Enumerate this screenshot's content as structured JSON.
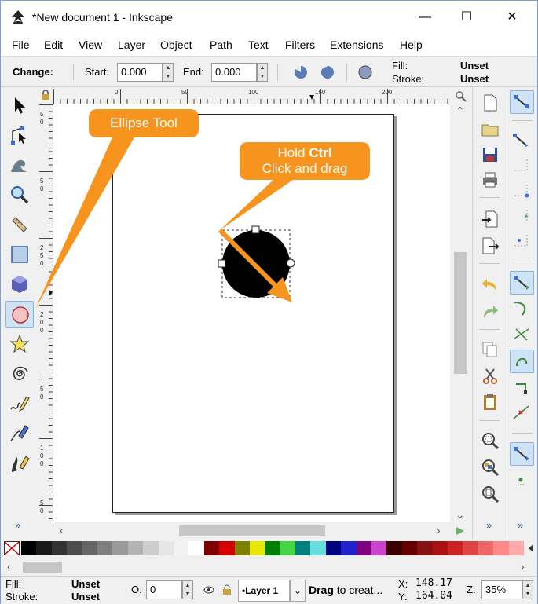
{
  "window": {
    "title": "*New document 1 - Inkscape",
    "minimize": "—",
    "maximize": "☐",
    "close": "✕"
  },
  "menu": [
    "File",
    "Edit",
    "View",
    "Layer",
    "Object",
    "Path",
    "Text",
    "Filters",
    "Extensions",
    "Help"
  ],
  "controls": {
    "change_label": "Change:",
    "start_label": "Start:",
    "start_value": "0.000",
    "end_label": "End:",
    "end_value": "0.000",
    "fill_label": "Fill:",
    "fill_value": "Unset",
    "stroke_label": "Stroke:",
    "stroke_value": "Unset"
  },
  "ruler": {
    "h": [
      "0",
      "50",
      "100",
      "150",
      "200"
    ],
    "v": [
      "5",
      "0",
      "5",
      "0",
      "2",
      "5",
      "0",
      "2",
      "0",
      "0",
      "1",
      "5",
      "0",
      "1",
      "0",
      "0",
      "5",
      "0"
    ]
  },
  "callouts": {
    "ellipse_tool": "Ellipse Tool",
    "hold": "Hold",
    "ctrl": "Ctrl",
    "click_drag": "Click  and drag"
  },
  "toolbox_more": "»",
  "cmd_more": "»",
  "snap_more": "»",
  "palette_colors": [
    "#000000",
    "#1a1a1a",
    "#333333",
    "#4d4d4d",
    "#666666",
    "#808080",
    "#999999",
    "#b3b3b3",
    "#cccccc",
    "#e6e6e6",
    "#f2f2f2",
    "#ffffff",
    "#800000",
    "#d40000",
    "#808000",
    "#e6e600",
    "#008000",
    "#44d444",
    "#008080",
    "#66dddd",
    "#000080",
    "#2222cc",
    "#800080",
    "#cc44cc",
    "#3a0000",
    "#660000",
    "#881111",
    "#aa1111",
    "#cc2222",
    "#dd4444",
    "#ee6666",
    "#ff8888",
    "#ffaaaa"
  ],
  "status": {
    "fill_label": "Fill:",
    "fill_value": "Unset",
    "stroke_label": "Stroke:",
    "stroke_value": "Unset",
    "opacity_label": "O:",
    "opacity_value": "0",
    "layer": "•Layer 1",
    "message_bold": "Drag",
    "message": " to creat...",
    "x_label": "X:",
    "x_value": "148.17",
    "y_label": "Y:",
    "y_value": "164.04",
    "zoom_label": "Z:",
    "zoom_value": "35%"
  }
}
